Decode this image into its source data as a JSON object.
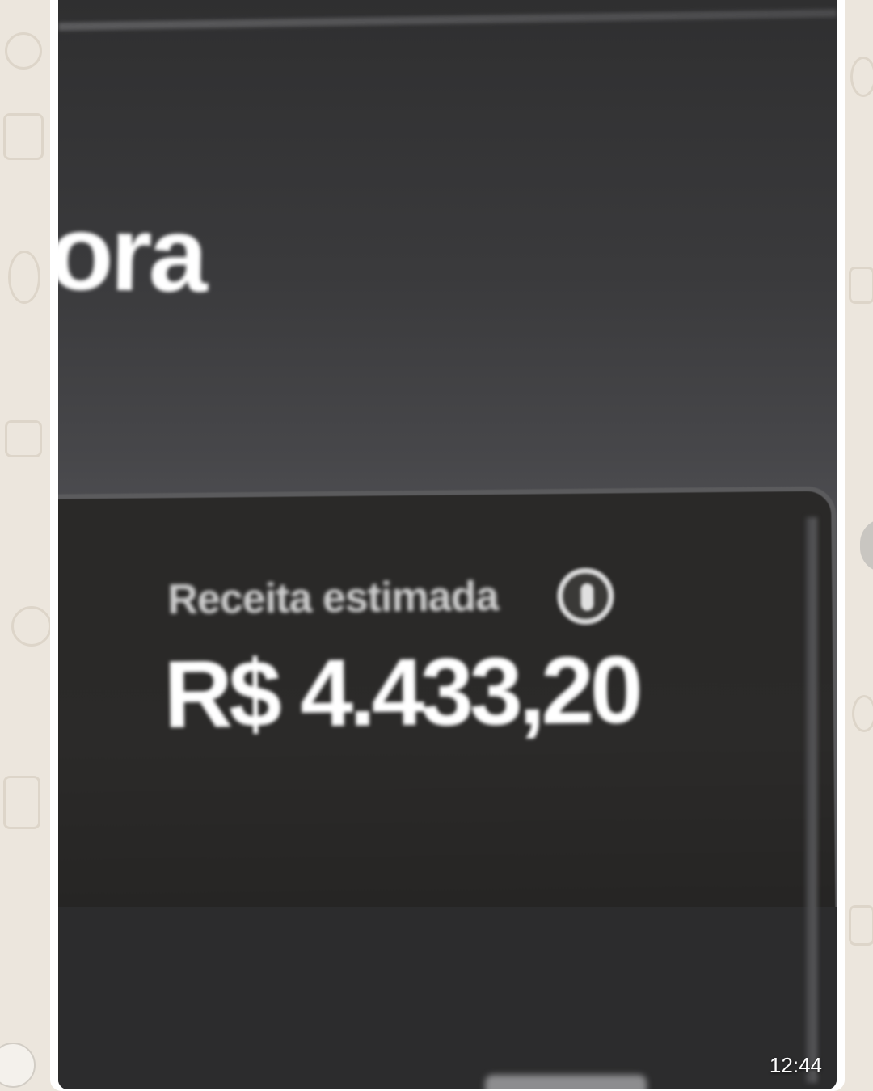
{
  "photo": {
    "partial_heading": "ora",
    "card": {
      "label": "Receita estimada",
      "value": "R$ 4.433,20",
      "info_icon": "info-icon"
    }
  },
  "message": {
    "timestamp": "12:44"
  },
  "colors": {
    "chat_background": "#ece6dd",
    "bubble": "#ffffff",
    "card_background": "#2a2928",
    "card_border": "#5b5b5d",
    "value_text": "#ffffff"
  }
}
